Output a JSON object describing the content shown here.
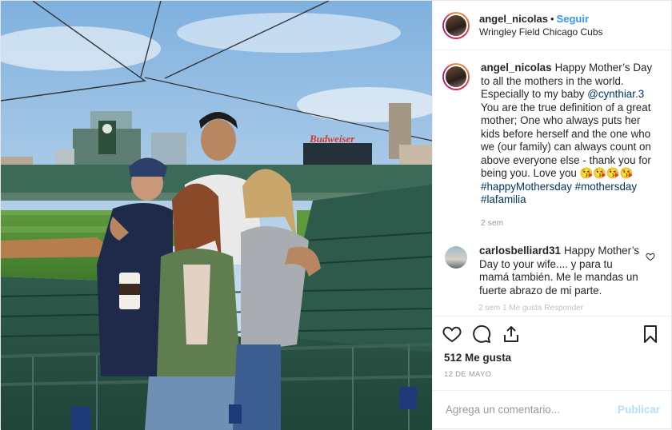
{
  "post": {
    "author": "angel_nicolas",
    "follow_label": "Seguir",
    "separator": "•",
    "location": "Wringley Field Chicago Cubs"
  },
  "photo": {
    "sign_text": "Budweiser"
  },
  "caption": {
    "username": "angel_nicolas",
    "text_1": "Happy Mother’s Day to all the mothers in the world. Especially to my baby",
    "mention": "@cynthiar.3",
    "text_2": "You are the true definition of a great mother; One who always puts her kids before herself and the one who we (our family) can always count on above everyone else - thank you for being you. Love you 😘😘😘😘",
    "hashtags": [
      "#happyMothersday",
      "#mothersday",
      "#lafamilia"
    ],
    "time": "2 sem"
  },
  "comment": {
    "username": "carlosbelliard31",
    "text": "Happy Mother’s Day to your wife.... y para tu mamá también. Me le mandas un fuerte abrazo de mi parte.",
    "meta": "2 sem    1 Me gusta    Responder"
  },
  "likes": "512 Me gusta",
  "date": "12 DE MAYO",
  "add_comment": {
    "placeholder": "Agrega un comentario...",
    "publish_label": "Publicar"
  },
  "colors": {
    "link": "#3897f0",
    "mention": "#003569",
    "publish_disabled": "#b2dffc"
  }
}
